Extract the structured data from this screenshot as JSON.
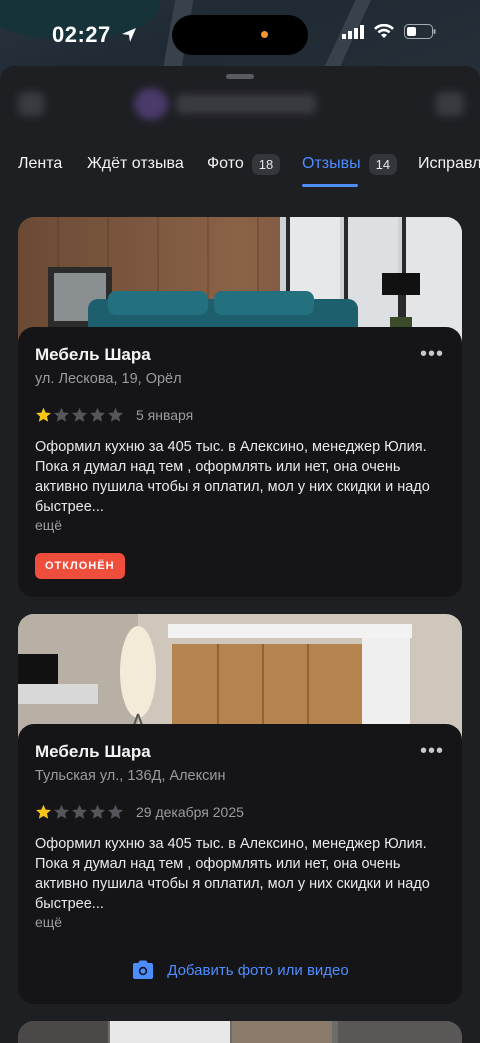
{
  "status": {
    "time": "02:27"
  },
  "tabs": [
    {
      "label": "Лента",
      "count": ""
    },
    {
      "label": "Ждёт отзыва",
      "count": ""
    },
    {
      "label": "Фото",
      "count": "18"
    },
    {
      "label": "Отзывы",
      "count": "14"
    },
    {
      "label": "Исправл",
      "count": ""
    }
  ],
  "active_tab": "Отзывы",
  "reviews": [
    {
      "org": "Мебель Шара",
      "address": "ул. Лескова, 19, Орёл",
      "rating": 1,
      "date": "5 января",
      "text": "Оформил кухню за 405 тыс. в Алексино, менеджер Юлия. Пока я думал над тем , оформлять или нет, она очень активно пушила чтобы я оплатил, мол у них скидки и надо быстрее...",
      "more": "ещё",
      "status": "ОТКЛОНЁН"
    },
    {
      "org": "Мебель Шара",
      "address": "Тульская ул., 136Д, Алексин",
      "rating": 1,
      "date": "29 декабря 2025",
      "text": "Оформил кухню за 405 тыс. в Алексино, менеджер Юлия. Пока я думал над тем , оформлять или нет, она очень активно пушила чтобы я оплатил, мол у них скидки и надо быстрее...",
      "more": "ещё",
      "action": "Добавить фото или видео"
    }
  ],
  "colors": {
    "accent": "#4c8dff",
    "rejected": "#f04e3c",
    "star": "#f5c518"
  },
  "icons": [
    "location-arrow-icon",
    "signal-icon",
    "wifi-icon",
    "battery-icon",
    "more-dots-icon",
    "star-icon",
    "camera-icon"
  ]
}
